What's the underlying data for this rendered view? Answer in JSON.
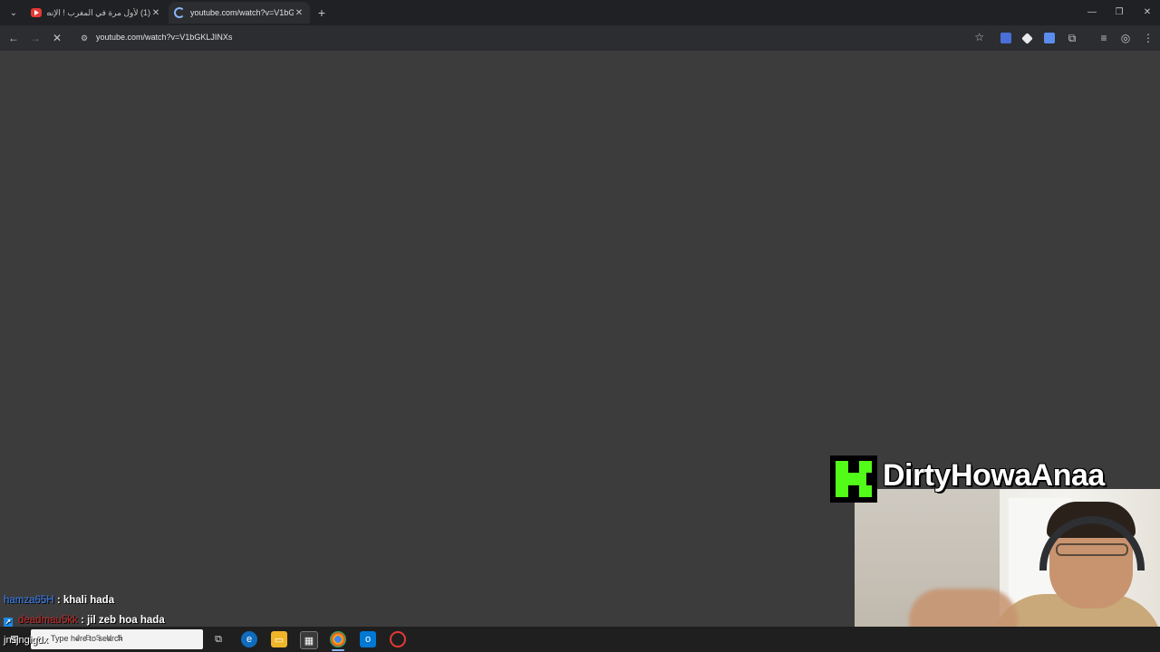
{
  "browser": {
    "tabs": [
      {
        "title": "(1) لأول مرة في المغرب ! الإنطلا"
      },
      {
        "title": "youtube.com/watch?v=V1bGKLJINXs"
      }
    ],
    "url": "youtube.com/watch?v=V1bGKLJINXs"
  },
  "stream": {
    "streamer_name": "DirtyHowaAnaa"
  },
  "chat": {
    "messages": [
      {
        "user": "hamza65H",
        "text": ": khali hada"
      },
      {
        "user": "deadmau5kk",
        "text": ": jil zeb hoa hada"
      }
    ],
    "overlay_fragment": "jnsjngigdx"
  },
  "taskbar": {
    "search_text": "Type here to search",
    "search_overlay": "J E S U S"
  },
  "colors": {
    "kick_green": "#53fc18",
    "page_bg": "#3c3c3c"
  }
}
